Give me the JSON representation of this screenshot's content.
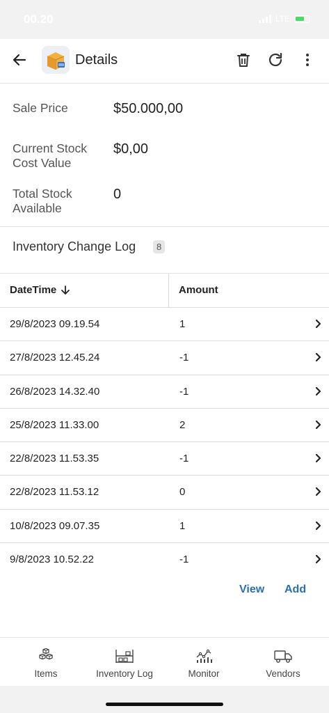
{
  "status_bar": {
    "time": "00.20",
    "network": "LTE"
  },
  "app_bar": {
    "title": "Details",
    "icons": {
      "back": "arrow-left-icon",
      "logo": "package-box-icon",
      "delete": "trash-icon",
      "refresh": "refresh-icon",
      "more": "more-vertical-icon"
    }
  },
  "details": {
    "sale_price_label": "Sale Price",
    "sale_price_value": "$50.000,00",
    "stock_cost_label_line1": "Current Stock",
    "stock_cost_label_line2": "Cost Value",
    "stock_cost_value": "$0,00",
    "total_stock_label_line1": "Total Stock",
    "total_stock_label_line2": "Available",
    "total_stock_value": "0"
  },
  "log": {
    "title": "Inventory Change Log",
    "count": "8",
    "columns": {
      "datetime": "DateTime",
      "amount": "Amount"
    },
    "sort": "descending",
    "rows": [
      {
        "datetime": "29/8/2023 09.19.54",
        "amount": "1"
      },
      {
        "datetime": "27/8/2023 12.45.24",
        "amount": "-1"
      },
      {
        "datetime": "26/8/2023 14.32.40",
        "amount": "-1"
      },
      {
        "datetime": "25/8/2023 11.33.00",
        "amount": "2"
      },
      {
        "datetime": "22/8/2023 11.53.35",
        "amount": "-1"
      },
      {
        "datetime": "22/8/2023 11.53.12",
        "amount": "0"
      },
      {
        "datetime": "10/8/2023 09.07.35",
        "amount": "1"
      },
      {
        "datetime": "9/8/2023 10.52.22",
        "amount": "-1"
      }
    ],
    "view_label": "View",
    "add_label": "Add"
  },
  "bottom_nav": {
    "items": [
      {
        "label": "Items",
        "icon": "cubes-icon"
      },
      {
        "label": "Inventory Log",
        "icon": "shelves-icon"
      },
      {
        "label": "Monitor",
        "icon": "line-chart-icon"
      },
      {
        "label": "Vendors",
        "icon": "truck-icon"
      }
    ]
  },
  "colors": {
    "accent": "#2a6fb5",
    "battery": "#4cd964"
  }
}
